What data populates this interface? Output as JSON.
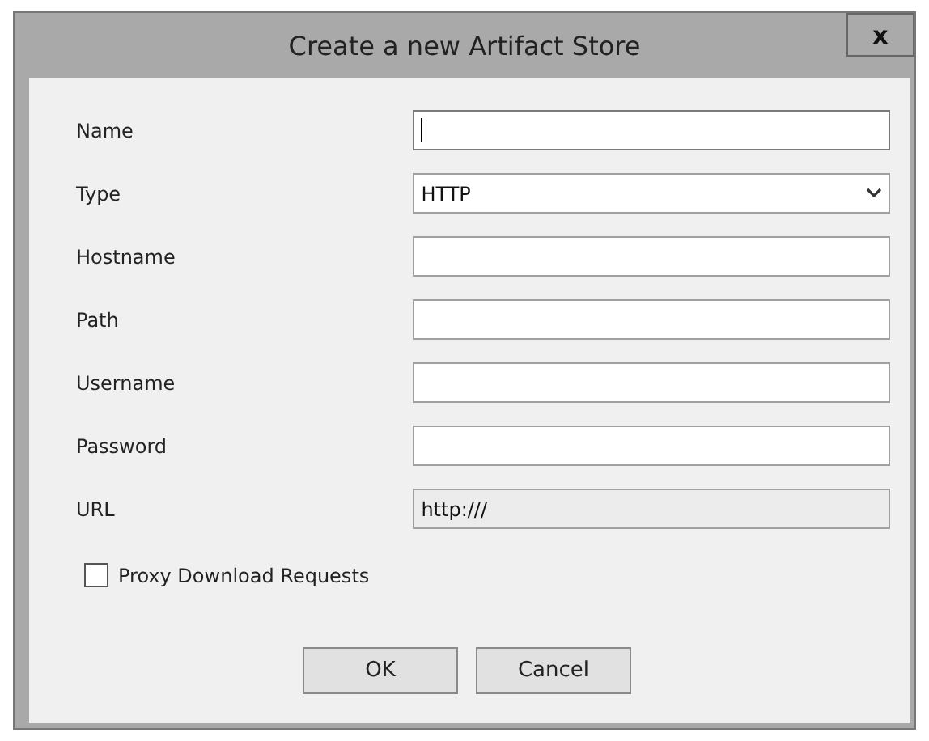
{
  "window": {
    "title": "Create a new Artifact Store",
    "close": "x"
  },
  "fields": [
    {
      "label": "Name",
      "kind": "text",
      "focused": true
    },
    {
      "label": "Type",
      "kind": "select",
      "value": "HTTP"
    },
    {
      "label": "Hostname",
      "kind": "text",
      "focused": false
    },
    {
      "label": "Path",
      "kind": "text",
      "focused": false
    },
    {
      "label": "Username",
      "kind": "text",
      "focused": false
    },
    {
      "label": "Password",
      "kind": "text",
      "focused": false
    },
    {
      "label": "URL",
      "kind": "readonly",
      "value": "http:///"
    }
  ],
  "checkbox": {
    "label": "Proxy Download Requests",
    "checked": false
  },
  "buttons": [
    "OK",
    "Cancel"
  ]
}
